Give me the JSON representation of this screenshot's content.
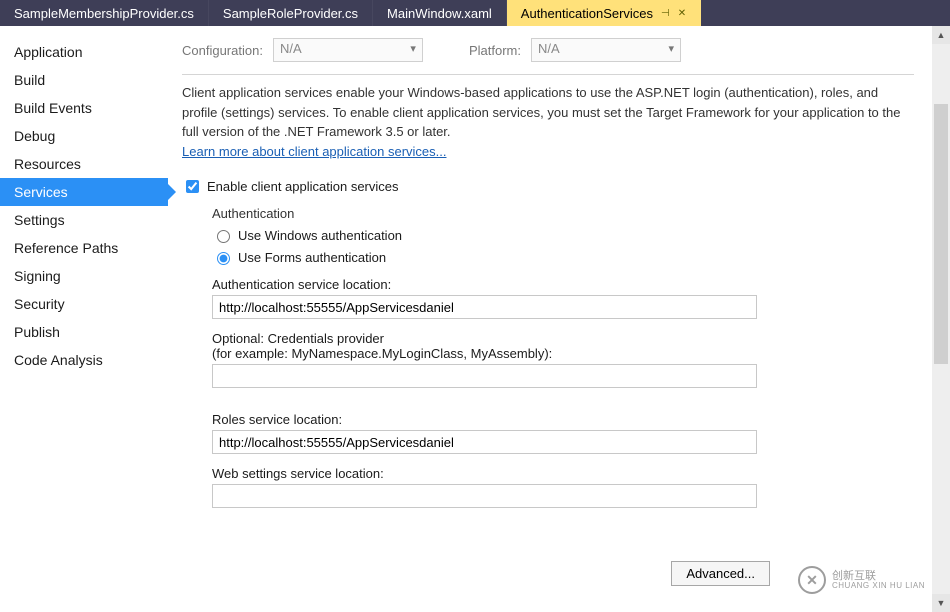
{
  "tabs": {
    "items": [
      {
        "label": "SampleMembershipProvider.cs",
        "active": false
      },
      {
        "label": "SampleRoleProvider.cs",
        "active": false
      },
      {
        "label": "MainWindow.xaml",
        "active": false
      },
      {
        "label": "AuthenticationServices",
        "active": true
      }
    ]
  },
  "sidebar": {
    "items": [
      "Application",
      "Build",
      "Build Events",
      "Debug",
      "Resources",
      "Services",
      "Settings",
      "Reference Paths",
      "Signing",
      "Security",
      "Publish",
      "Code Analysis"
    ],
    "active_index": 5
  },
  "top": {
    "config_label": "Configuration:",
    "config_value": "N/A",
    "platform_label": "Platform:",
    "platform_value": "N/A"
  },
  "desc": {
    "text": "Client application services enable your Windows-based applications to use the ASP.NET login (authentication), roles, and profile (settings) services. To enable client application services, you must set the Target Framework for your application to the full version of the .NET Framework 3.5 or later.",
    "link": "Learn more about client application services..."
  },
  "services": {
    "enable_label": "Enable client application services",
    "auth_group": "Authentication",
    "radio_windows": "Use Windows authentication",
    "radio_forms": "Use Forms authentication",
    "auth_loc_label": "Authentication service location:",
    "auth_loc_value": "http://localhost:55555/AppServicesdaniel",
    "cred_label_1": "Optional: Credentials provider",
    "cred_label_2": "(for example: MyNamespace.MyLoginClass, MyAssembly):",
    "cred_value": "",
    "roles_label": "Roles service location:",
    "roles_value": "http://localhost:55555/AppServicesdaniel",
    "websettings_label": "Web settings service location:",
    "websettings_value": "",
    "advanced_btn": "Advanced..."
  },
  "watermark": {
    "line1": "创新互联",
    "line2": "CHUANG XIN HU LIAN"
  }
}
